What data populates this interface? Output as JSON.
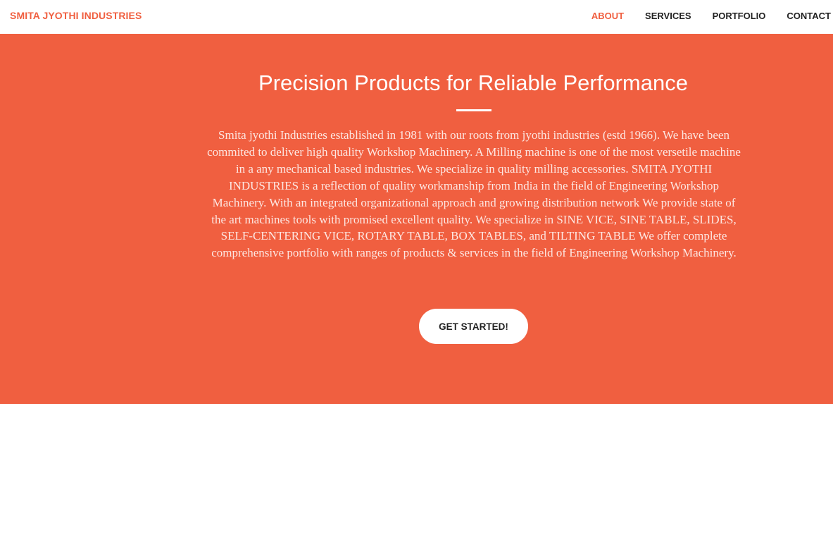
{
  "navbar": {
    "brand": "SMITA JYOTHI INDUSTRIES",
    "links": [
      {
        "label": "ABOUT",
        "active": true
      },
      {
        "label": "SERVICES",
        "active": false
      },
      {
        "label": "PORTFOLIO",
        "active": false
      },
      {
        "label": "CONTACT",
        "active": false
      }
    ]
  },
  "hero": {
    "title": "Precision Products for Reliable Performance",
    "description": "Smita jyothi Industries established in 1981 with our roots from jyothi industries (estd 1966). We have been commited to deliver high quality Workshop Machinery. A Milling machine is one of the most versetile machine in a any mechanical based industries. We specialize in quality milling accessories. SMITA JYOTHI INDUSTRIES is a reflection of quality workmanship from India in the field of Engineering Workshop Machinery. With an integrated organizational approach and growing distribution network We provide state of the art machines tools with promised excellent quality. We specialize in SINE VICE, SINE TABLE, SLIDES, SELF-CENTERING VICE, ROTARY TABLE, BOX TABLES, and TILTING TABLE We offer complete comprehensive portfolio with ranges of products & services in the field of Engineering Workshop Machinery.",
    "cta_label": "GET STARTED!"
  },
  "colors": {
    "primary": "#f05f40",
    "nav_text": "#222222",
    "background": "#ffffff"
  }
}
